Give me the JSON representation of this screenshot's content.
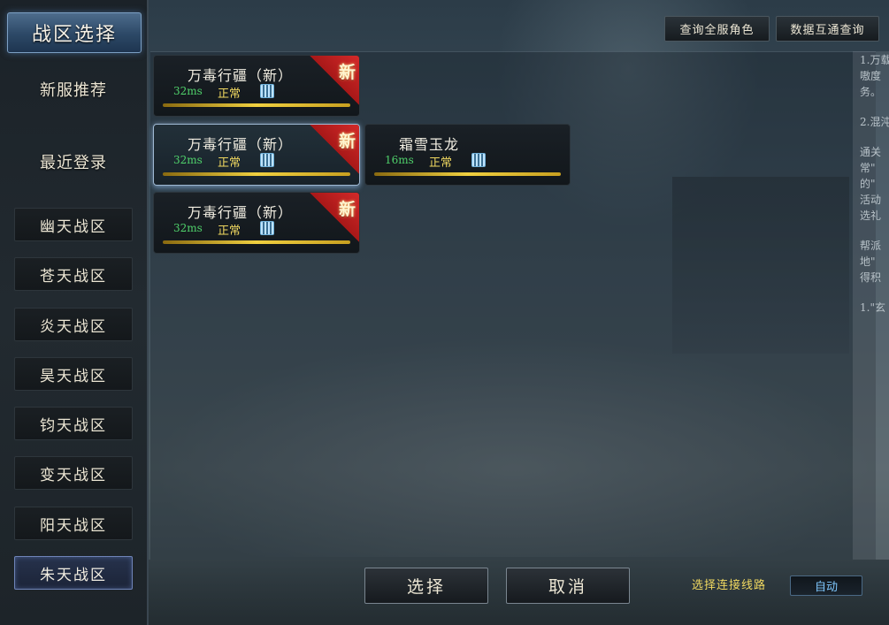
{
  "window": {
    "title": "战区选择"
  },
  "sidebar": {
    "links": [
      {
        "label": "新服推荐"
      },
      {
        "label": "最近登录"
      }
    ],
    "zones": [
      {
        "label": "幽天战区"
      },
      {
        "label": "苍天战区"
      },
      {
        "label": "炎天战区"
      },
      {
        "label": "昊天战区"
      },
      {
        "label": "钧天战区"
      },
      {
        "label": "变天战区"
      },
      {
        "label": "阳天战区"
      },
      {
        "label": "朱天战区"
      }
    ],
    "active_zone": "朱天战区"
  },
  "toolbar": {
    "query_all_roles": "查询全服角色",
    "data_interop_query": "数据互通查询"
  },
  "servers": [
    {
      "name": "万毒行疆（新）",
      "ping": "32ms",
      "status": "正常",
      "badge": "新"
    },
    {
      "name": "万毒行疆（新）",
      "ping": "32ms",
      "status": "正常",
      "badge": "新",
      "selected": true
    },
    {
      "name": "霜雪玉龙",
      "ping": "16ms",
      "status": "正常"
    },
    {
      "name": "万毒行疆（新）",
      "ping": "32ms",
      "status": "正常",
      "badge": "新"
    }
  ],
  "right_info": {
    "lines": [
      "1.万载",
      "嗷度",
      "务。",
      "2.混沌",
      "通关",
      "常\"",
      "的\"",
      "活动",
      "选礼",
      "帮派",
      "地\"",
      "得积",
      "1.\"玄"
    ]
  },
  "footer": {
    "select_label": "选择",
    "cancel_label": "取消",
    "line_label": "选择连接线路",
    "line_value": "自动"
  },
  "colors": {
    "ping": "#4fd06a",
    "status": "#f0d860",
    "badge": "#d42a2a",
    "selected_border": "#9fb8d2"
  }
}
